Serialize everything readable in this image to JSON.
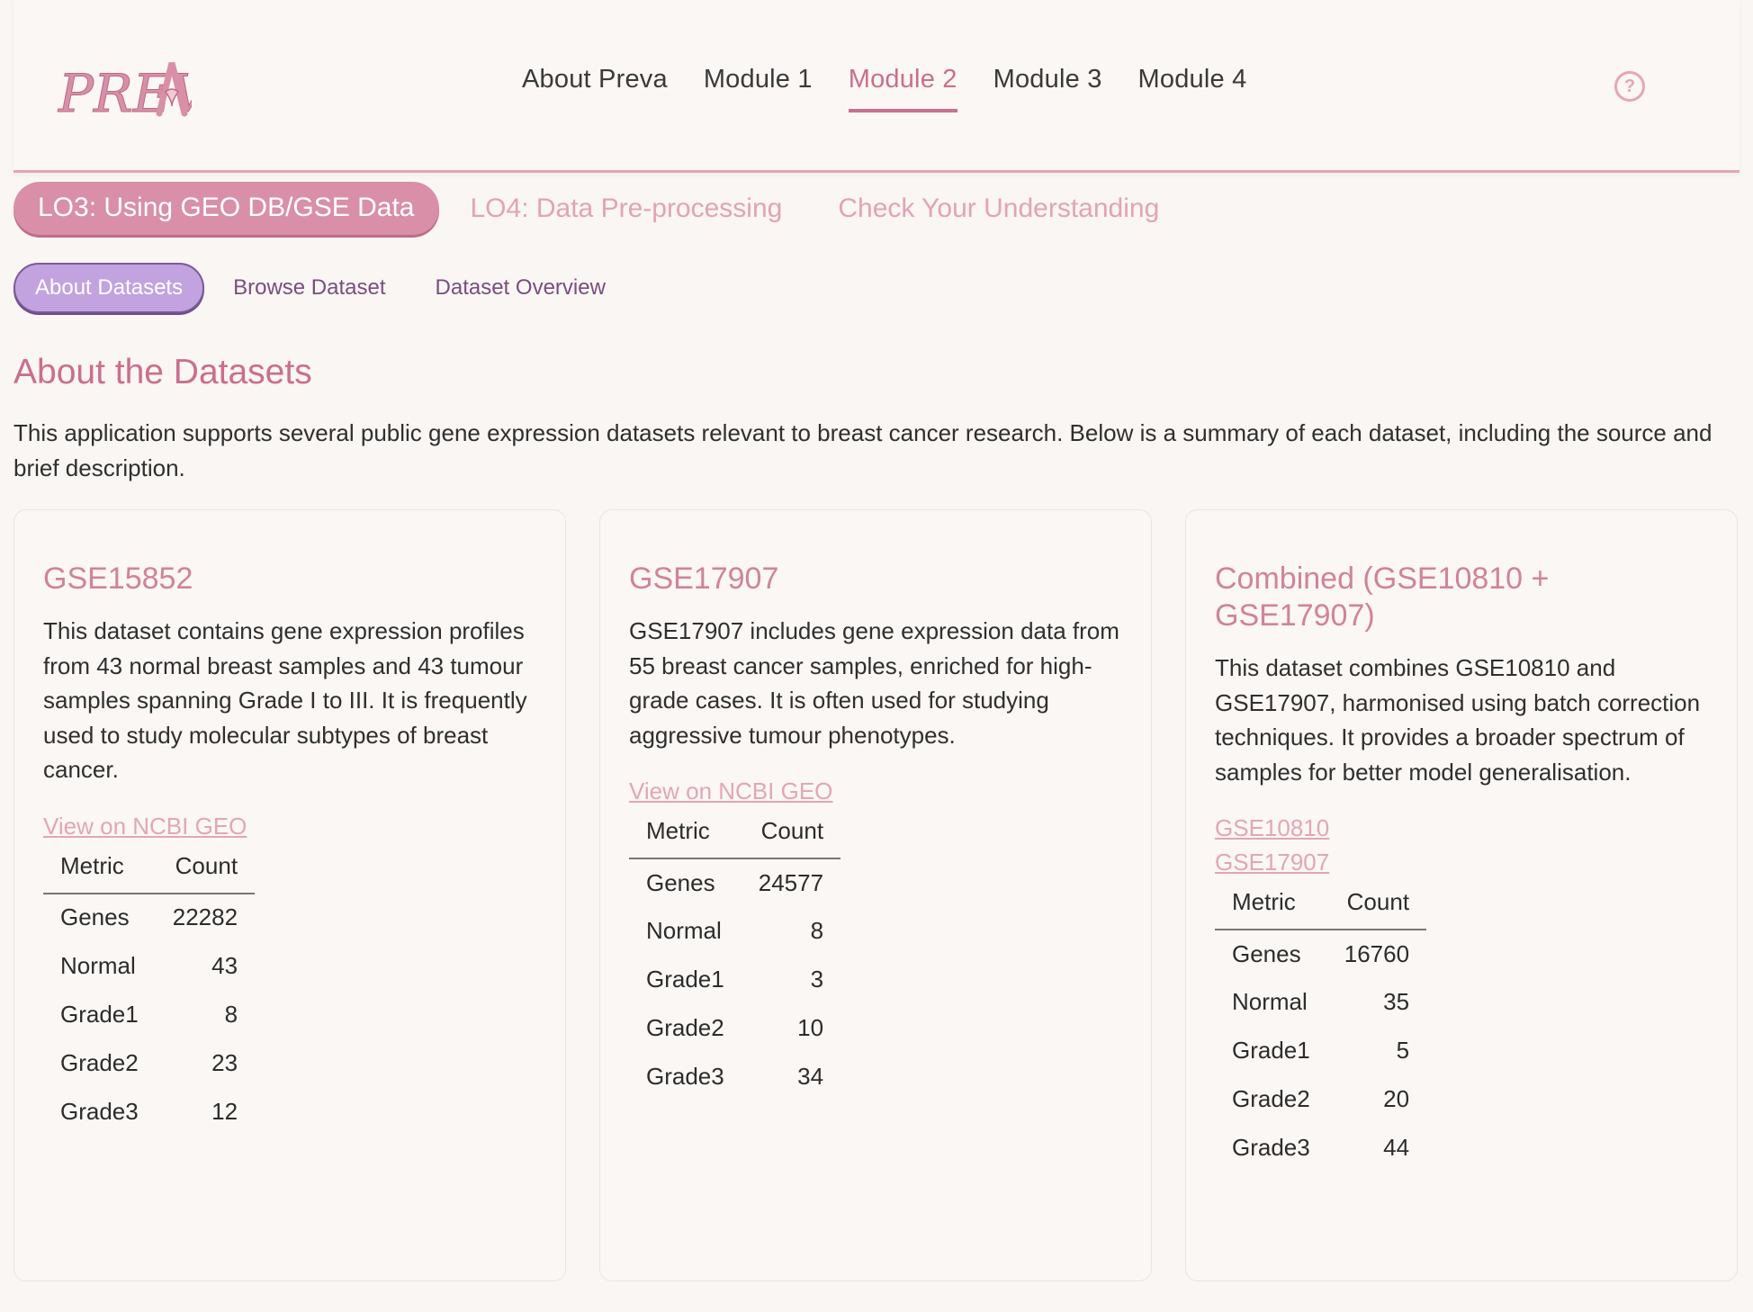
{
  "header": {
    "logo_text": "PREVA",
    "nav": [
      {
        "label": "About Preva",
        "active": false
      },
      {
        "label": "Module 1",
        "active": false
      },
      {
        "label": "Module 2",
        "active": true
      },
      {
        "label": "Module 3",
        "active": false
      },
      {
        "label": "Module 4",
        "active": false
      }
    ],
    "help_icon": "question-circle-icon",
    "help_glyph": "?"
  },
  "lo_tabs": [
    {
      "label": "LO3: Using GEO DB/GSE Data",
      "active": true
    },
    {
      "label": "LO4: Data Pre-processing",
      "active": false
    },
    {
      "label": "Check Your Understanding",
      "active": false
    }
  ],
  "sub_tabs": [
    {
      "label": "About Datasets",
      "active": true
    },
    {
      "label": "Browse Dataset",
      "active": false
    },
    {
      "label": "Dataset Overview",
      "active": false
    }
  ],
  "main": {
    "title": "About the Datasets",
    "intro": "This application supports several public gene expression datasets relevant to breast cancer research. Below is a summary of each dataset, including the source and brief description."
  },
  "cards": [
    {
      "title": "GSE15852",
      "description": "This dataset contains gene expression profiles from 43 normal breast samples and 43 tumour samples spanning Grade I to III. It is frequently used to study molecular subtypes of breast cancer.",
      "links": [
        "View on NCBI GEO"
      ],
      "table": {
        "headers": [
          "Metric",
          "Count"
        ],
        "rows": [
          [
            "Genes",
            "22282"
          ],
          [
            "Normal",
            "43"
          ],
          [
            "Grade1",
            "8"
          ],
          [
            "Grade2",
            "23"
          ],
          [
            "Grade3",
            "12"
          ]
        ]
      }
    },
    {
      "title": "GSE17907",
      "description": "GSE17907 includes gene expression data from 55 breast cancer samples, enriched for high-grade cases. It is often used for studying aggressive tumour phenotypes.",
      "links": [
        "View on NCBI GEO"
      ],
      "table": {
        "headers": [
          "Metric",
          "Count"
        ],
        "rows": [
          [
            "Genes",
            "24577"
          ],
          [
            "Normal",
            "8"
          ],
          [
            "Grade1",
            "3"
          ],
          [
            "Grade2",
            "10"
          ],
          [
            "Grade3",
            "34"
          ]
        ]
      }
    },
    {
      "title": "Combined (GSE10810 + GSE17907)",
      "description": "This dataset combines GSE10810 and GSE17907, harmonised using batch correction techniques. It provides a broader spectrum of samples for better model generalisation.",
      "links": [
        "GSE10810",
        "GSE17907"
      ],
      "table": {
        "headers": [
          "Metric",
          "Count"
        ],
        "rows": [
          [
            "Genes",
            "16760"
          ],
          [
            "Normal",
            "35"
          ],
          [
            "Grade1",
            "5"
          ],
          [
            "Grade2",
            "20"
          ],
          [
            "Grade3",
            "44"
          ]
        ]
      }
    }
  ],
  "colors": {
    "accent": "#c96f8f",
    "accent_light": "#e2a6b8",
    "lo_active_bg": "#d98fa7",
    "subtab_active_bg": "#c2a3df",
    "subtab_text": "#7a4d7e",
    "background": "#f9f6f3"
  }
}
